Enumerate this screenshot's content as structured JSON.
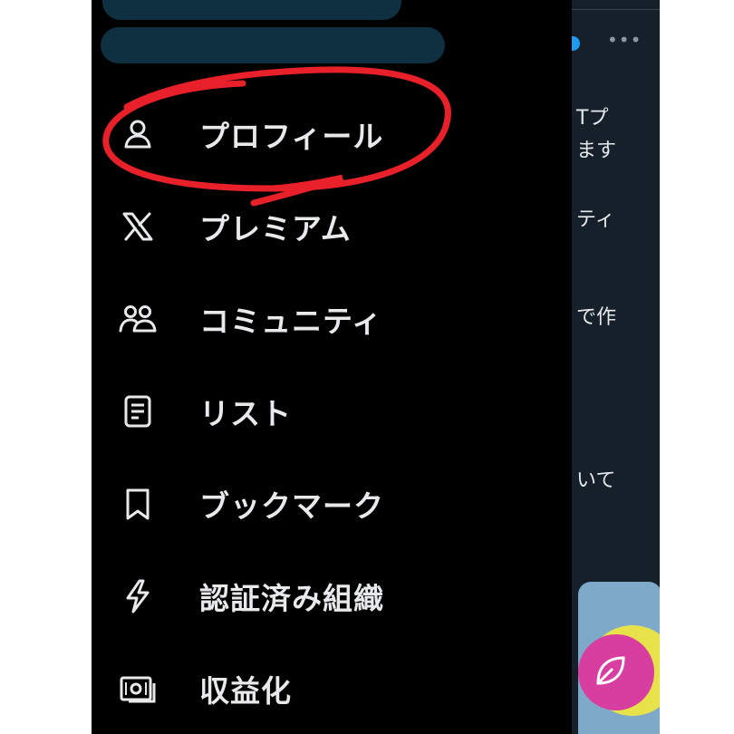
{
  "drawer": {
    "items": [
      {
        "label": "プロフィール",
        "icon": "person-icon"
      },
      {
        "label": "プレミアム",
        "icon": "x-logo-icon"
      },
      {
        "label": "コミュニティ",
        "icon": "communities-icon"
      },
      {
        "label": "リスト",
        "icon": "list-icon"
      },
      {
        "label": "ブックマーク",
        "icon": "bookmark-icon"
      },
      {
        "label": "認証済み組織",
        "icon": "lightning-icon"
      },
      {
        "label": "収益化",
        "icon": "money-icon"
      }
    ]
  },
  "timeline": {
    "more_label": "•••",
    "fragments": [
      "Tプ",
      "ます",
      "ティ",
      "で作",
      "いて"
    ]
  },
  "colors": {
    "drawer_bg": "#000000",
    "text": "#e7e9ea",
    "timeline_bg": "#15202b",
    "annotation": "#e8202a",
    "redaction": "#0e3040"
  }
}
